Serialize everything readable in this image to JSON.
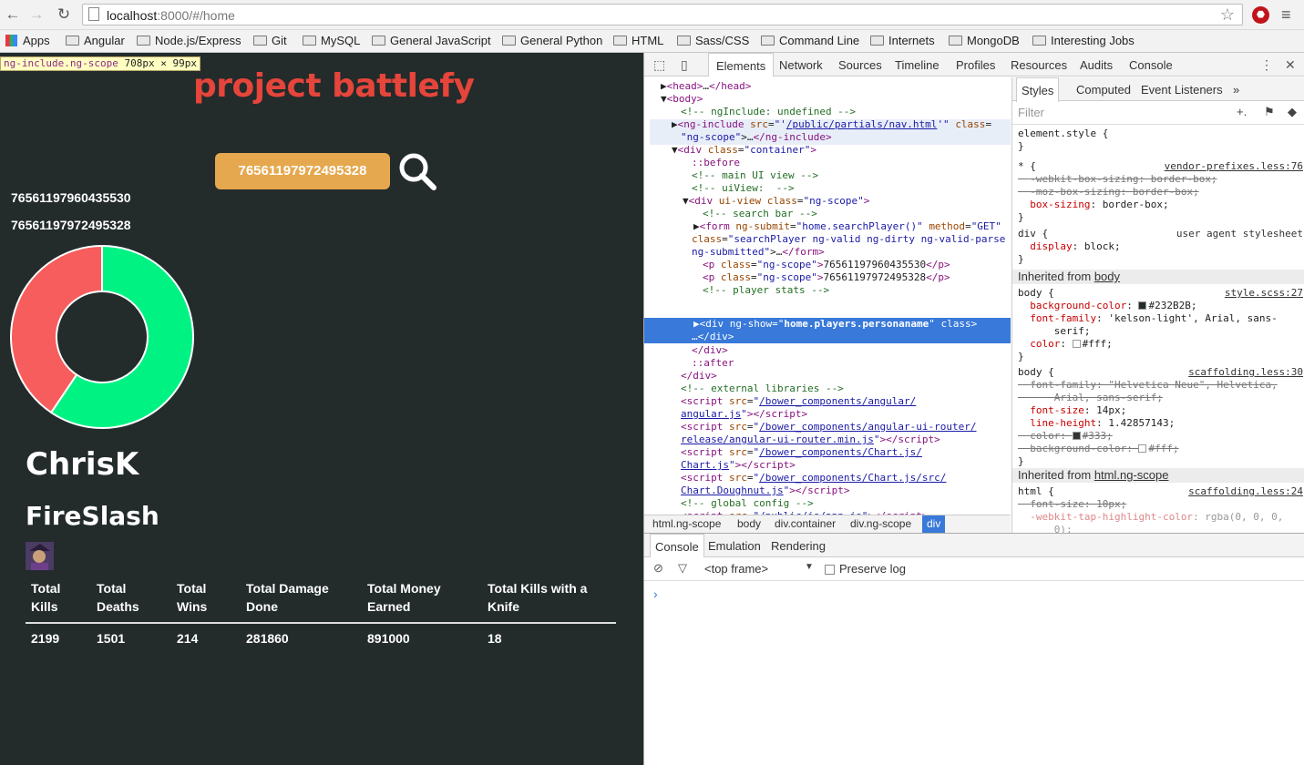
{
  "browser": {
    "url_host": "localhost",
    "url_rest": ":8000/#/home",
    "bookmarks": [
      "Apps",
      "Angular",
      "Node.js/Express",
      "Git",
      "MySQL",
      "General JavaScript",
      "General Python",
      "HTML",
      "Sass/CSS",
      "Command Line",
      "Internets",
      "MongoDB",
      "Interesting Jobs"
    ]
  },
  "inspect_tip": {
    "label": "ng-include.ng-scope",
    "dims": "708px × 99px"
  },
  "app": {
    "brand": "project battlefy",
    "search_value": "76561197972495328",
    "ids": [
      "76561197960435530",
      "76561197972495328"
    ],
    "players": [
      "ChrisK",
      "FireSlash"
    ],
    "stats_headers": [
      [
        "Total",
        "Kills"
      ],
      [
        "Total",
        "Deaths"
      ],
      [
        "Total",
        "Wins"
      ],
      [
        "Total Damage",
        "Done"
      ],
      [
        "Total Money",
        "Earned"
      ],
      [
        "Total Kills with a",
        "Knife"
      ]
    ],
    "stats_values": [
      "2199",
      "1501",
      "214",
      "281860",
      "891000",
      "18"
    ],
    "colors": {
      "bg": "#232B2B",
      "brand": "#e5453b",
      "search": "#e6a84e",
      "slice_red": "#f75d5d",
      "slice_green": "#00f283"
    }
  },
  "chart_data": {
    "type": "pie",
    "variant": "doughnut",
    "values": [
      1501,
      2199
    ],
    "colors": [
      "#f75d5d",
      "#00f283"
    ]
  },
  "devtools": {
    "tabs": [
      "Elements",
      "Network",
      "Sources",
      "Timeline",
      "Profiles",
      "Resources",
      "Audits",
      "Console"
    ],
    "breadcrumbs": [
      "html.ng-scope",
      "body",
      "div.container",
      "div.ng-scope",
      "div"
    ],
    "styles_tabs": [
      "Styles",
      "Computed",
      "Event Listeners",
      "»"
    ],
    "filter_placeholder": "Filter",
    "drawer_tabs": [
      "Console",
      "Emulation",
      "Rendering"
    ],
    "frame": "<top frame>",
    "preserve_log": "Preserve log"
  }
}
